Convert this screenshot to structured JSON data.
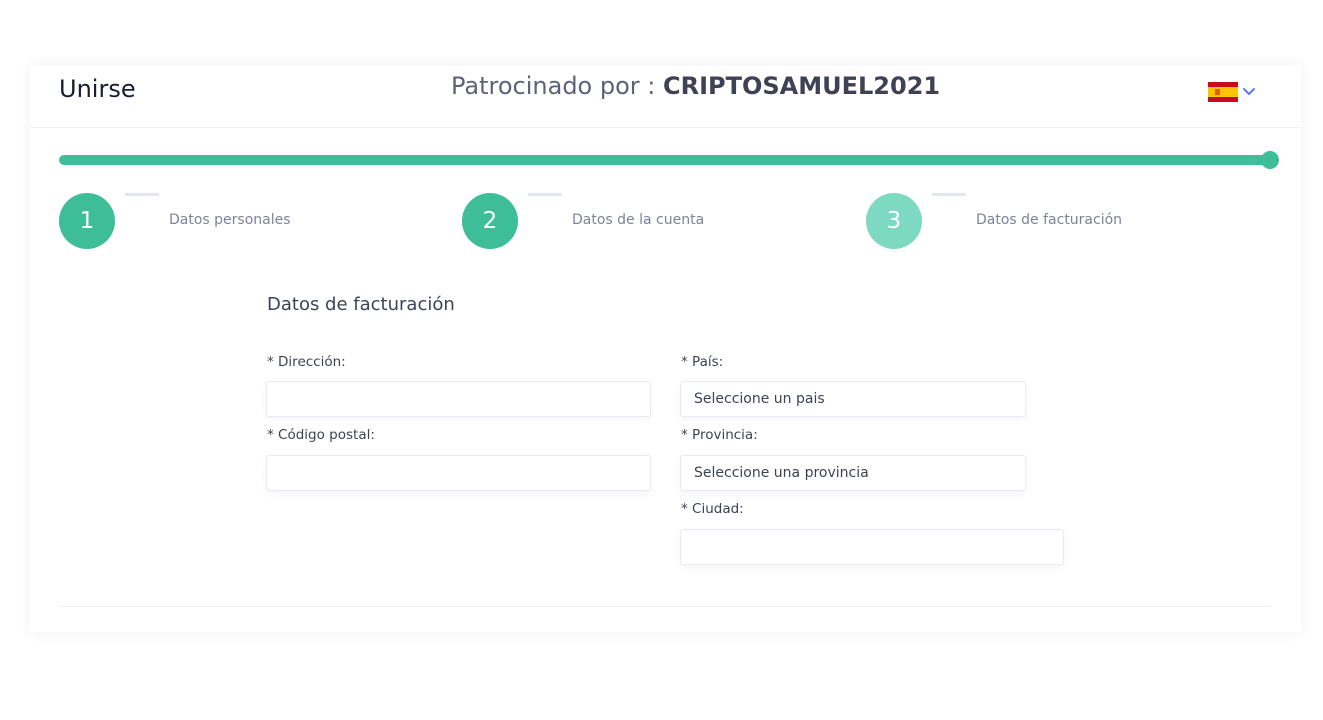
{
  "header": {
    "title": "Unirse",
    "sponsor_prefix": "Patrocinado por : ",
    "sponsor_name": "CRIPTOSAMUEL2021",
    "language_flag": "spain-flag-icon"
  },
  "progress": {
    "percent": 100,
    "color": "#3dbe99"
  },
  "steps": [
    {
      "number": "1",
      "label": "Datos personales",
      "color": "#3dbe99"
    },
    {
      "number": "2",
      "label": "Datos de la cuenta",
      "color": "#3dbe99"
    },
    {
      "number": "3",
      "label": "Datos de facturación",
      "color": "#7dd9c2"
    }
  ],
  "form": {
    "section_title": "Datos de facturación",
    "direccion": {
      "label": "* Dirección:",
      "value": ""
    },
    "codigo_postal": {
      "label": "* Código postal:",
      "value": ""
    },
    "pais": {
      "label": "* País:",
      "selected": "Seleccione un pais"
    },
    "provincia": {
      "label": "* Provincia:",
      "selected": "Seleccione una provincia"
    },
    "ciudad": {
      "label": "* Ciudad:",
      "value": ""
    }
  }
}
